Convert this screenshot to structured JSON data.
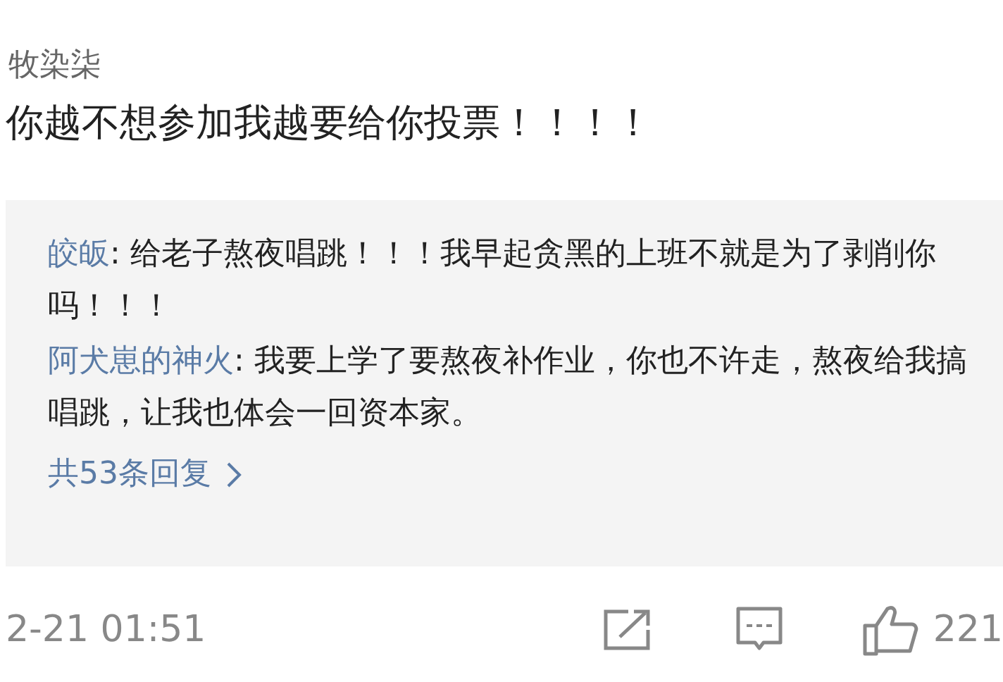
{
  "comment": {
    "username": "牧染柒",
    "text": "你越不想参加我越要给你投票！！！！"
  },
  "replies": [
    {
      "name": "皎皈",
      "text": ": 给老子熬夜唱跳！！！我早起贪黑的上班不就是为了剥削你吗！！！"
    },
    {
      "name": "阿犬崽的神火",
      "text": ": 我要上学了要熬夜补作业，你也不许走，熬夜给我搞唱跳，让我也体会一回资本家。"
    }
  ],
  "more_replies": "共53条回复",
  "footer": {
    "time": "2-21 01:51",
    "likes": "221"
  }
}
